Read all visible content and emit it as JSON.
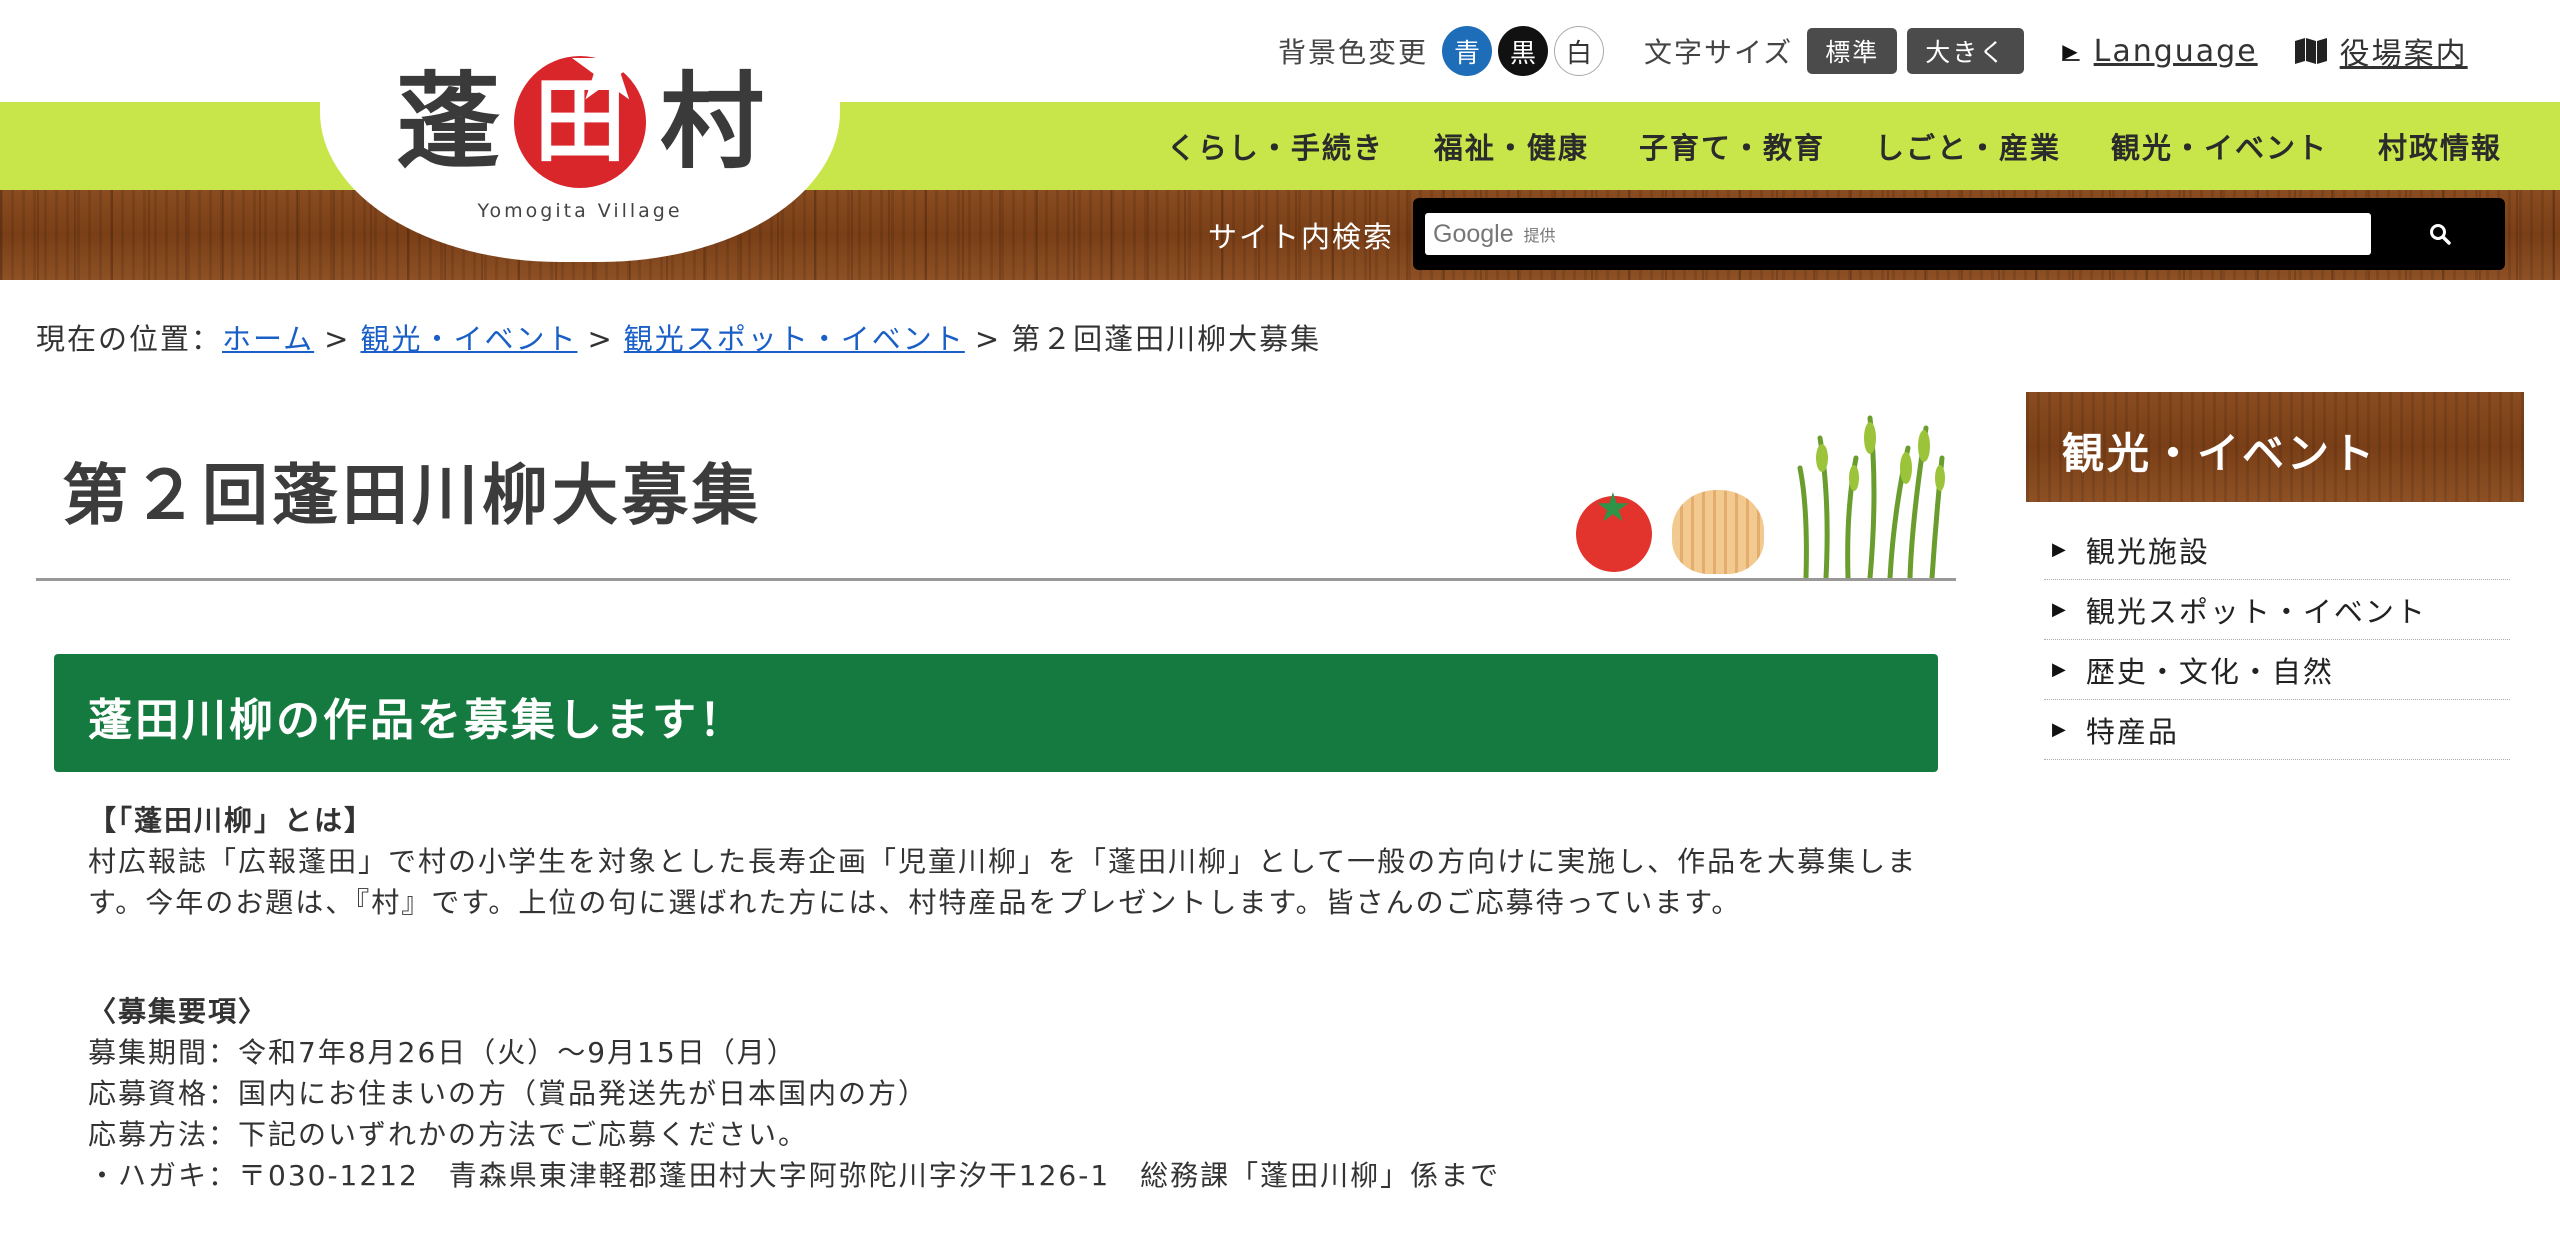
{
  "header": {
    "logo": {
      "char1": "蓬",
      "char2": "田",
      "char3": "村",
      "subtitle": "Yomogita Village"
    },
    "utility": {
      "bg_label": "背景色変更",
      "bg_blue": "青",
      "bg_black": "黒",
      "bg_white": "白",
      "font_label": "文字サイズ",
      "font_standard": "標準",
      "font_large": "大きく",
      "language": "Language",
      "office_guide": "役場案内"
    },
    "nav": [
      "くらし・手続き",
      "福祉・健康",
      "子育て・教育",
      "しごと・産業",
      "観光・イベント",
      "村政情報"
    ],
    "search": {
      "label": "サイト内検索",
      "google": "Google",
      "provided": "提供",
      "button_icon": "search-icon"
    }
  },
  "breadcrumb": {
    "prefix": "現在の位置：",
    "items": [
      "ホーム",
      "観光・イベント",
      "観光スポット・イベント"
    ],
    "current": "第２回蓬田川柳大募集",
    "separator": ">"
  },
  "main": {
    "title": "第２回蓬田川柳大募集",
    "section_heading": "蓬田川柳の作品を募集します！",
    "about_heading": "【「蓬田川柳」とは】",
    "about_text": "村広報誌「広報蓬田」で村の小学生を対象とした長寿企画「児童川柳」を「蓬田川柳」として一般の方向けに実施し、作品を大募集します。今年のお題は、『村』です。上位の句に選ばれた方には、村特産品をプレゼントします。皆さんのご応募待っています。",
    "guide_heading": "〈募集要項〉",
    "guide_lines": [
      "募集期間：令和7年8月26日（火）～9月15日（月）",
      "応募資格：国内にお住まいの方（賞品発送先が日本国内の方）",
      "応募方法：下記のいずれかの方法でご応募ください。",
      "・ハガキ：〒030-1212　青森県東津軽郡蓬田村大字阿弥陀川字汐干126-1　総務課「蓬田川柳」係まで"
    ]
  },
  "sidebar": {
    "heading": "観光・イベント",
    "items": [
      "観光施設",
      "観光スポット・イベント",
      "歴史・文化・自然",
      "特産品"
    ]
  },
  "colors": {
    "nav_green": "#c8e64a",
    "section_green": "#157a40",
    "wood_brown": "#7a3f17",
    "link_blue": "#1a5fc7",
    "logo_red": "#d9262b"
  }
}
